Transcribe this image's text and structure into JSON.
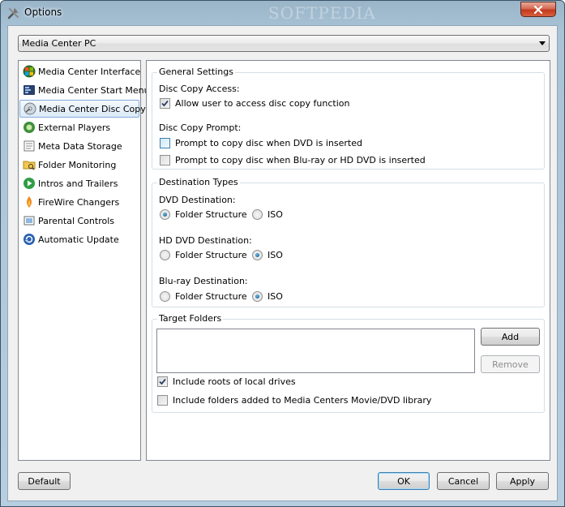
{
  "window": {
    "title": "Options",
    "watermark": "SOFTPEDIA"
  },
  "profile_select": {
    "value": "Media Center PC"
  },
  "nav": {
    "items": [
      {
        "label": "Media Center Interface",
        "icon": "windows-logo-icon"
      },
      {
        "label": "Media Center Start Menu",
        "icon": "start-menu-icon"
      },
      {
        "label": "Media Center Disc Copy",
        "icon": "disc-copy-icon",
        "selected": true
      },
      {
        "label": "External Players",
        "icon": "external-player-icon"
      },
      {
        "label": "Meta Data Storage",
        "icon": "metadata-icon"
      },
      {
        "label": "Folder Monitoring",
        "icon": "folder-search-icon"
      },
      {
        "label": "Intros and Trailers",
        "icon": "play-icon"
      },
      {
        "label": "FireWire Changers",
        "icon": "firewire-icon"
      },
      {
        "label": "Parental Controls",
        "icon": "parental-icon"
      },
      {
        "label": "Automatic Update",
        "icon": "update-icon"
      }
    ]
  },
  "general": {
    "title": "General Settings",
    "access_label": "Disc Copy Access:",
    "allow_access": {
      "label": "Allow user to access disc copy function",
      "checked": true
    },
    "prompt_label": "Disc Copy Prompt:",
    "prompt_dvd": {
      "label": "Prompt to copy disc when DVD is inserted",
      "checked": false
    },
    "prompt_bluray": {
      "label": "Prompt to copy disc when Blu-ray or HD DVD is inserted",
      "checked": false
    }
  },
  "destination": {
    "title": "Destination Types",
    "dvd": {
      "label": "DVD Destination:",
      "selected": "Folder Structure"
    },
    "hddvd": {
      "label": "HD DVD Destination:",
      "selected": "ISO"
    },
    "bluray": {
      "label": "Blu-ray Destination:",
      "selected": "ISO"
    },
    "option_folder": "Folder Structure",
    "option_iso": "ISO"
  },
  "targets": {
    "title": "Target Folders",
    "add_label": "Add",
    "remove_label": "Remove",
    "include_roots": {
      "label": "Include roots of local drives",
      "checked": true
    },
    "include_library": {
      "label": "Include folders added to Media Centers Movie/DVD library",
      "checked": false
    }
  },
  "footer": {
    "default_label": "Default",
    "ok_label": "OK",
    "cancel_label": "Cancel",
    "apply_label": "Apply"
  }
}
